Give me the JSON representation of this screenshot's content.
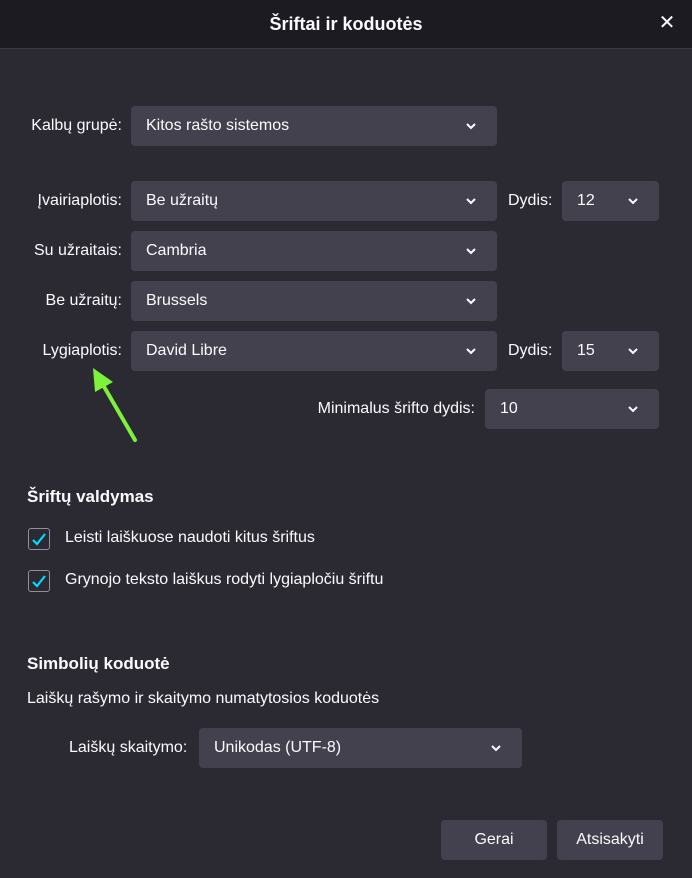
{
  "dialog": {
    "title": "Šriftai ir koduotės"
  },
  "language_group": {
    "label": "Kalbų grupė:",
    "value": "Kitos rašto sistemos"
  },
  "proportional": {
    "label": "Įvairiaplotis:",
    "value": "Be užraitų",
    "size_label": "Dydis:",
    "size_value": "12"
  },
  "serif": {
    "label": "Su užraitais:",
    "value": "Cambria"
  },
  "sans_serif": {
    "label": "Be užraitų:",
    "value": "Brussels"
  },
  "monospace": {
    "label": "Lygiaplotis:",
    "value": "David Libre",
    "size_label": "Dydis:",
    "size_value": "15"
  },
  "min_font": {
    "label": "Minimalus šrifto dydis:",
    "value": "10"
  },
  "font_control": {
    "heading": "Šriftų valdymas",
    "options": [
      {
        "label": "Leisti laiškuose naudoti kitus šriftus",
        "checked": true
      },
      {
        "label": "Grynojo teksto laiškus rodyti lygiapločiu šriftu",
        "checked": true
      }
    ]
  },
  "encoding": {
    "heading": "Simbolių koduotė",
    "description": "Laiškų rašymo ir skaitymo numatytosios koduotės",
    "reading_label": "Laiškų skaitymo:",
    "reading_value": "Unikodas (UTF-8)"
  },
  "buttons": {
    "ok": "Gerai",
    "cancel": "Atsisakyti"
  },
  "colors": {
    "background": "#2b2a33",
    "field": "#42414d",
    "accent": "#0df",
    "annotation_arrow": "#7cf23a"
  }
}
